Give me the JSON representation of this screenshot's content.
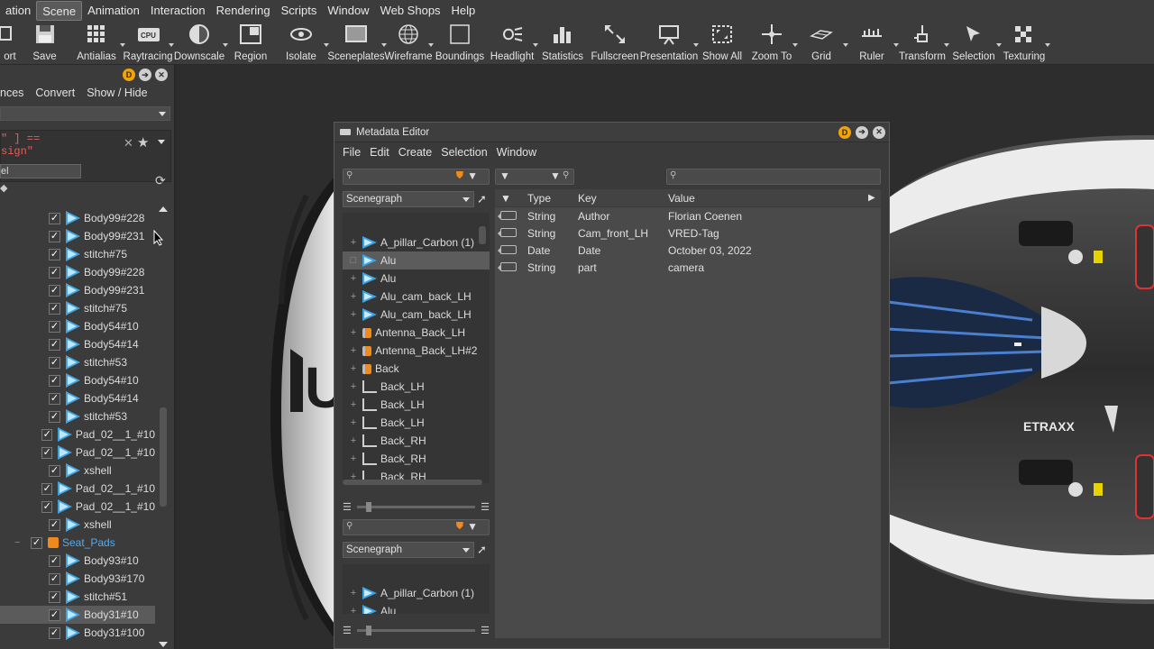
{
  "menubar": {
    "items": [
      "ation",
      "Scene",
      "Animation",
      "Interaction",
      "Rendering",
      "Scripts",
      "Window",
      "Web Shops",
      "Help"
    ],
    "active_index": 1
  },
  "toolbar": {
    "buttons": [
      {
        "label": "ort",
        "icon": "export-icon"
      },
      {
        "label": "Save",
        "icon": "save-icon"
      },
      {
        "label": "Antialias",
        "icon": "antialias-icon"
      },
      {
        "label": "Raytracing",
        "icon": "cpu-icon"
      },
      {
        "label": "Downscale",
        "icon": "downscale-icon"
      },
      {
        "label": "Region",
        "icon": "region-icon"
      },
      {
        "label": "Isolate",
        "icon": "eye-icon"
      },
      {
        "label": "Sceneplates",
        "icon": "sceneplates-icon"
      },
      {
        "label": "Wireframe",
        "icon": "wireframe-icon"
      },
      {
        "label": "Boundings",
        "icon": "boundings-icon"
      },
      {
        "label": "Headlight",
        "icon": "headlight-icon"
      },
      {
        "label": "Statistics",
        "icon": "statistics-icon"
      },
      {
        "label": "Fullscreen",
        "icon": "fullscreen-icon"
      },
      {
        "label": "Presentation",
        "icon": "presentation-icon"
      },
      {
        "label": "Show All",
        "icon": "show-all-icon"
      },
      {
        "label": "Zoom To",
        "icon": "zoom-to-icon"
      },
      {
        "label": "Grid",
        "icon": "grid-icon"
      },
      {
        "label": "Ruler",
        "icon": "ruler-icon"
      },
      {
        "label": "Transform",
        "icon": "transform-icon"
      },
      {
        "label": "Selection",
        "icon": "selection-icon"
      },
      {
        "label": "Texturing",
        "icon": "texturing-icon"
      }
    ]
  },
  "left_panel": {
    "menu": [
      "nces",
      "Convert",
      "Show / Hide"
    ],
    "search_text_1": "\" ] ==",
    "search_text_2": "sign\"",
    "field_label": "el",
    "rows": [
      {
        "label": "Body99#228",
        "type": "geom",
        "checked": true
      },
      {
        "label": "Body99#231",
        "type": "geom",
        "checked": true
      },
      {
        "label": "stitch#75",
        "type": "geom",
        "checked": true
      },
      {
        "label": "Body99#228",
        "type": "geom",
        "checked": true
      },
      {
        "label": "Body99#231",
        "type": "geom",
        "checked": true
      },
      {
        "label": "stitch#75",
        "type": "geom",
        "checked": true
      },
      {
        "label": "Body54#10",
        "type": "geom",
        "checked": true
      },
      {
        "label": "Body54#14",
        "type": "geom",
        "checked": true
      },
      {
        "label": "stitch#53",
        "type": "geom",
        "checked": true
      },
      {
        "label": "Body54#10",
        "type": "geom",
        "checked": true
      },
      {
        "label": "Body54#14",
        "type": "geom",
        "checked": true
      },
      {
        "label": "stitch#53",
        "type": "geom",
        "checked": true
      },
      {
        "label": "Pad_02__1_#10",
        "type": "geom",
        "checked": true
      },
      {
        "label": "Pad_02__1_#10",
        "type": "geom",
        "checked": true
      },
      {
        "label": "xshell",
        "type": "geom",
        "checked": true
      },
      {
        "label": "Pad_02__1_#10",
        "type": "geom",
        "checked": true
      },
      {
        "label": "Pad_02__1_#10",
        "type": "geom",
        "checked": true
      },
      {
        "label": "xshell",
        "type": "geom",
        "checked": true
      },
      {
        "label": "Seat_Pads",
        "type": "group",
        "checked": true
      },
      {
        "label": "Body93#10",
        "type": "geom",
        "checked": true
      },
      {
        "label": "Body93#170",
        "type": "geom",
        "checked": true
      },
      {
        "label": "stitch#51",
        "type": "geom",
        "checked": true
      },
      {
        "label": "Body31#10",
        "type": "geom",
        "checked": true,
        "selected": true
      },
      {
        "label": "Body31#100",
        "type": "geom",
        "checked": true
      }
    ]
  },
  "metadata_editor": {
    "title": "Metadata Editor",
    "menu": [
      "File",
      "Edit",
      "Create",
      "Selection",
      "Window"
    ],
    "scenegraph_label": "Scenegraph",
    "tree_top": [
      {
        "label": "A_pillar_Carbon (1)",
        "type": "geom"
      },
      {
        "label": "Alu",
        "type": "geom",
        "selected": true
      },
      {
        "label": "Alu",
        "type": "geom"
      },
      {
        "label": "Alu_cam_back_LH",
        "type": "geom"
      },
      {
        "label": "Alu_cam_back_LH",
        "type": "geom"
      },
      {
        "label": "Antenna_Back_LH",
        "type": "group"
      },
      {
        "label": "Antenna_Back_LH#2",
        "type": "group"
      },
      {
        "label": "Back",
        "type": "group"
      },
      {
        "label": "Back_LH",
        "type": "joint"
      },
      {
        "label": "Back_LH",
        "type": "joint"
      },
      {
        "label": "Back_LH",
        "type": "joint"
      },
      {
        "label": "Back_RH",
        "type": "joint"
      },
      {
        "label": "Back_RH",
        "type": "joint"
      },
      {
        "label": "Back_RH",
        "type": "joint"
      }
    ],
    "tree_bottom": [
      {
        "label": "A_pillar_Carbon (1)",
        "type": "geom"
      },
      {
        "label": "Alu",
        "type": "geom"
      }
    ],
    "table": {
      "headers": [
        "Type",
        "Key",
        "Value"
      ],
      "rows": [
        {
          "type": "String",
          "key": "Author",
          "value": "Florian Coenen"
        },
        {
          "type": "String",
          "key": "Cam_front_LH",
          "value": "VRED-Tag"
        },
        {
          "type": "Date",
          "key": "Date",
          "value": "October 03, 2022"
        },
        {
          "type": "String",
          "key": "part",
          "value": "camera"
        }
      ]
    }
  },
  "colors": {
    "accent_blue": "#3fa3e0",
    "group_orange": "#f08a1a",
    "badge_orange": "#f0a30a"
  }
}
